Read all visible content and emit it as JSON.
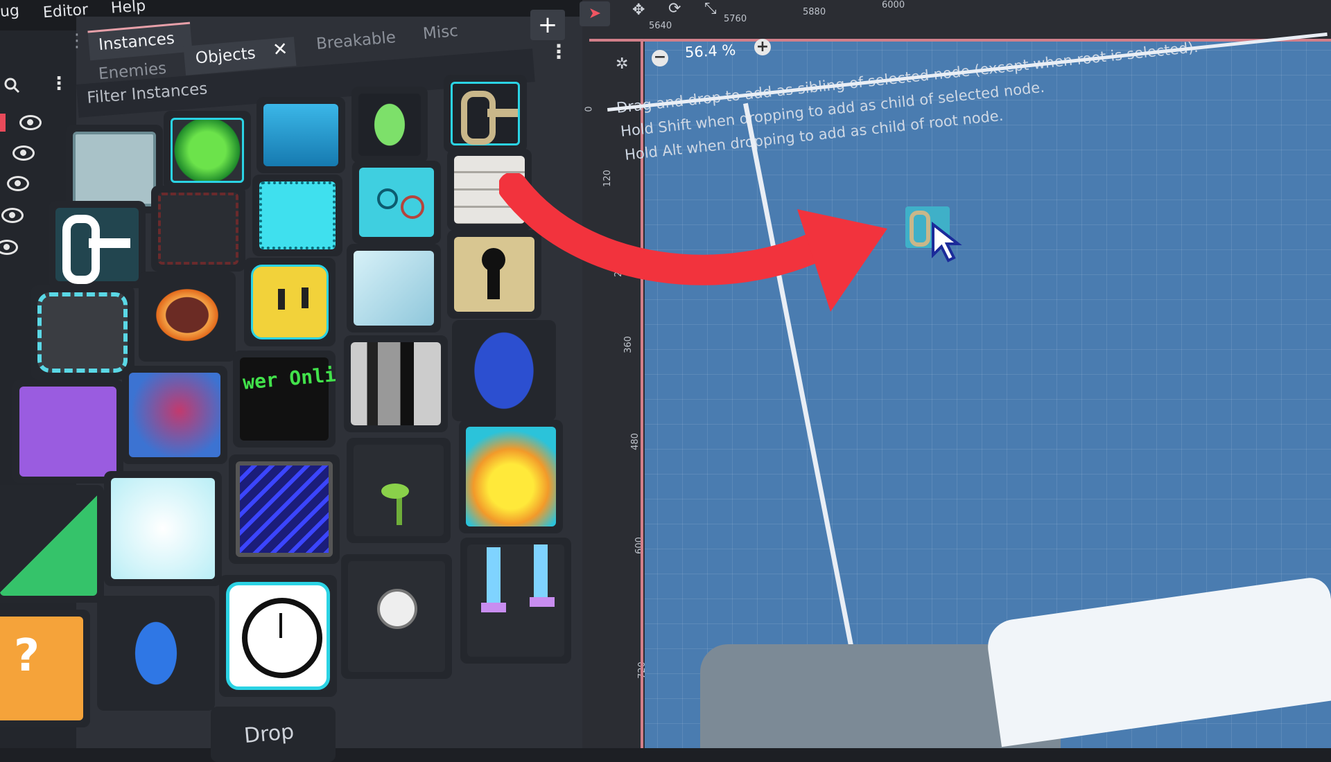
{
  "menubar": {
    "items": [
      "ug",
      "Editor",
      "Help"
    ]
  },
  "panel": {
    "tabs_top": [
      "Instances"
    ],
    "tabs_sub": [
      "Enemies",
      "Objects",
      "Breakable",
      "Misc"
    ],
    "active_sub_tab": "Objects",
    "filter_label": "Filter Instances",
    "add_icon": "plus-icon",
    "menu_icon": "kebab-icon",
    "close_icon": "close-icon",
    "grid": {
      "tile_text_online": "wer Onli",
      "tile_text_drop": "Drop"
    }
  },
  "viewport": {
    "zoom": "56.4 %",
    "ruler_top_labels": [
      "5640",
      "5760",
      "5880",
      "6000"
    ],
    "ruler_left_labels": [
      "0",
      "120",
      "240",
      "360",
      "480",
      "600",
      "720"
    ],
    "hints": [
      "Drag and drop to add as sibling of selected node (except when root is selected).",
      "Hold Shift when dropping to add as child of selected node.",
      "Hold Alt when dropping to add as child of root node."
    ]
  },
  "colors": {
    "viewport_bg": "#4a7cb0",
    "arrow": "#f2333d",
    "panel_bg": "#2e3138",
    "cyan": "#2bd3e4"
  }
}
